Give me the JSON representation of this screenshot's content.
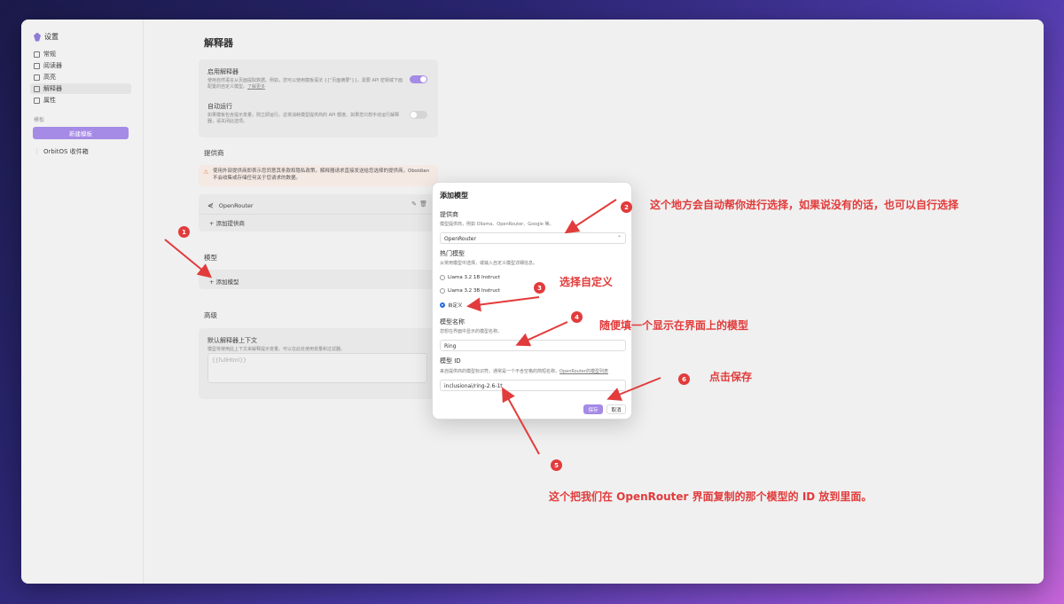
{
  "sidebar": {
    "title": "设置",
    "items": [
      {
        "label": "常规",
        "icon": "link-icon"
      },
      {
        "label": "阅读器",
        "icon": "book-icon"
      },
      {
        "label": "高亮",
        "icon": "pen-icon"
      },
      {
        "label": "解释器",
        "icon": "code-icon"
      },
      {
        "label": "属性",
        "icon": "list-icon"
      }
    ],
    "active_index": 3,
    "section_label": "模板",
    "new_template_button": "新建模板",
    "vault_label": "OrbitOS 收件箱"
  },
  "main": {
    "title": "解释器",
    "enable": {
      "title": "启用解释器",
      "desc": "使用自然语言从页面提取数据。例如，您可以使用模板语法 {{\"页面摘要\"}}。需要 API 密钥或下面配置的自定义模型。",
      "link": "了解更多",
      "on": true
    },
    "autorun": {
      "title": "自动运行",
      "desc": "如果模板包含提示变量，则立即运行。这将消耗模型提供商的 API 额度。如果您只想手动运行解释器，请关闭此选项。",
      "on": false
    },
    "providers_heading": "提供商",
    "warning": "使用外部提供商即表示您同意其条款和隐私政策。解释器请求直接发送给您选择的提供商，Obsidian 不会收集或存储任何关于您请求的数据。",
    "provider_name": "OpenRouter",
    "add_provider": "+ 添加提供商",
    "models_heading": "模型",
    "add_model": "+ 添加模型",
    "advanced_heading": "高级",
    "default_context": {
      "title": "默认解释器上下文",
      "desc": "模型将使用此上下文来解释提示变量。可以在此处使用变量和过滤器。",
      "placeholder": "{{fullHtml}}"
    }
  },
  "modal": {
    "title": "添加模型",
    "provider_label": "提供商",
    "provider_desc": "模型提供商，例如 Ollama、OpenRouter、Google 等。",
    "provider_value": "OpenRouter",
    "popular_label": "热门模型",
    "popular_desc": "从常用模型中选择，或输入自定义模型详细信息。",
    "options": [
      "Llama 3.2 1B Instruct",
      "Llama 3.2 3B Instruct",
      "自定义"
    ],
    "selected_option": 2,
    "name_label": "模型名称",
    "name_desc": "您想在界面中显示的模型名称。",
    "name_value": "Ring",
    "id_label": "模型 ID",
    "id_desc": "来自提供商的模型标识符。通常是一个不含空格的简短名称。",
    "id_link": "OpenRouter的模型列表",
    "id_value": "inclusionai/ring-2.6-1t",
    "save": "保存",
    "cancel": "取消"
  },
  "annotations": [
    {
      "num": "1",
      "text": ""
    },
    {
      "num": "2",
      "text": "这个地方会自动帮你进行选择，如果说没有的话，也可以自行选择"
    },
    {
      "num": "3",
      "text": "选择自定义"
    },
    {
      "num": "4",
      "text": "随便填一个显示在界面上的模型"
    },
    {
      "num": "5",
      "text": "这个把我们在 OpenRouter 界面复制的那个模型的 ID 放到里面。"
    },
    {
      "num": "6",
      "text": "点击保存"
    }
  ],
  "colors": {
    "accent": "#a58ae6",
    "annotation": "#e23b3b"
  }
}
